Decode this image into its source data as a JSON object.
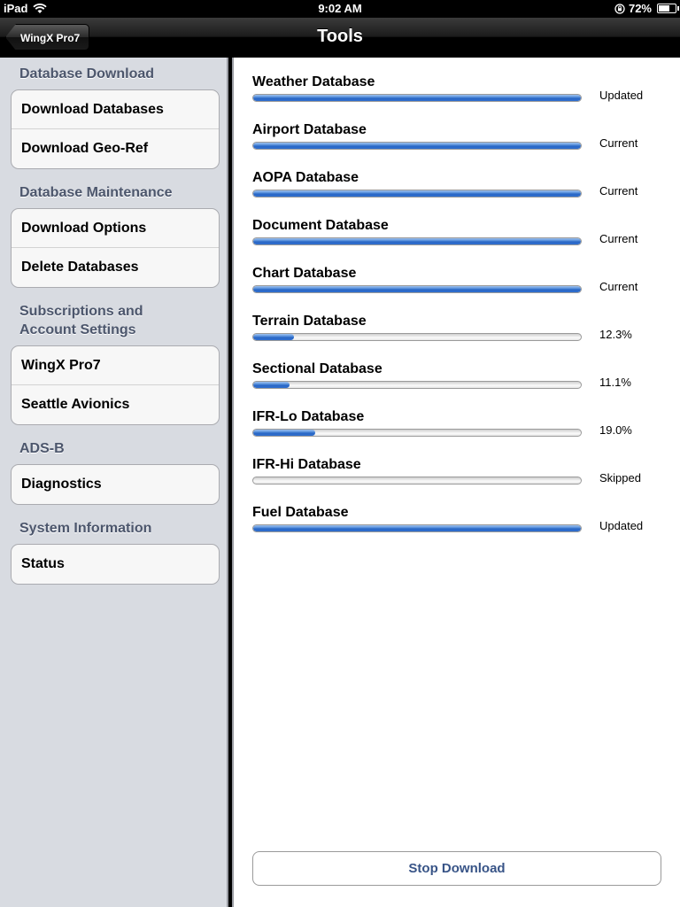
{
  "status_bar": {
    "device": "iPad",
    "time": "9:02 AM",
    "battery": "72%",
    "battery_level": 0.72
  },
  "nav": {
    "back_label": "WingX Pro7",
    "title": "Tools"
  },
  "sidebar": {
    "sections": [
      {
        "header": "Database Download",
        "items": [
          "Download Databases",
          "Download Geo-Ref"
        ]
      },
      {
        "header": "Database Maintenance",
        "items": [
          "Download Options",
          "Delete Databases"
        ]
      },
      {
        "header_line1": "Subscriptions and",
        "header_line2": "Account Settings",
        "items": [
          "WingX Pro7",
          "Seattle Avionics"
        ]
      },
      {
        "header": "ADS-B",
        "items": [
          "Diagnostics"
        ]
      },
      {
        "header": "System Information",
        "items": [
          "Status"
        ]
      }
    ]
  },
  "databases": [
    {
      "name": "Weather Database",
      "status": "Updated",
      "progress": 1.0
    },
    {
      "name": "Airport Database",
      "status": "Current",
      "progress": 1.0
    },
    {
      "name": "AOPA Database",
      "status": "Current",
      "progress": 1.0
    },
    {
      "name": "Document Database",
      "status": "Current",
      "progress": 1.0
    },
    {
      "name": "Chart Database",
      "status": "Current",
      "progress": 1.0
    },
    {
      "name": "Terrain Database",
      "status": "12.3%",
      "progress": 0.123
    },
    {
      "name": "Sectional Database",
      "status": "11.1%",
      "progress": 0.111
    },
    {
      "name": "IFR-Lo Database",
      "status": "19.0%",
      "progress": 0.19
    },
    {
      "name": "IFR-Hi Database",
      "status": "Skipped",
      "progress": 0.0
    },
    {
      "name": "Fuel Database",
      "status": "Updated",
      "progress": 1.0
    }
  ],
  "stop_button": "Stop Download",
  "colors": {
    "progress_fill": "#2f6fd0",
    "section_header": "#4c566c",
    "stop_button_text": "#385487",
    "sidebar_bg": "#d8dbe1"
  }
}
